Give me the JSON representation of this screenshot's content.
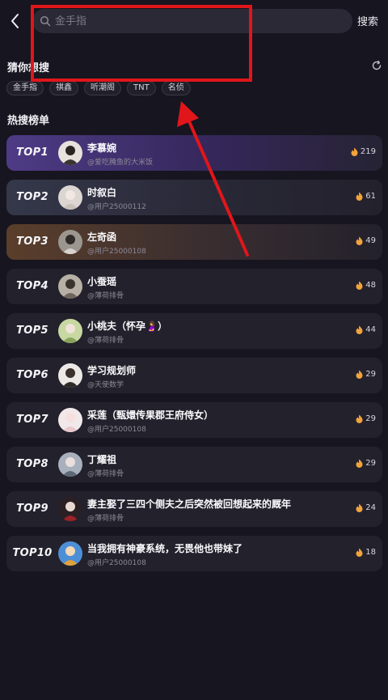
{
  "header": {
    "search_placeholder": "金手指",
    "search_button": "搜索"
  },
  "guess": {
    "title": "猜你想搜",
    "chips": [
      "金手指",
      "祺鑫",
      "听潮阁",
      "TNT",
      "名侦"
    ]
  },
  "hot": {
    "title": "热搜榜单",
    "items": [
      {
        "rank": "TOP1",
        "name": "李慕婉",
        "author": "@爱吃腌鱼的大米饭",
        "heat": "219"
      },
      {
        "rank": "TOP2",
        "name": "时叙白",
        "author": "@用户25000112",
        "heat": "61"
      },
      {
        "rank": "TOP3",
        "name": "左奇函",
        "author": "@用户25000108",
        "heat": "49"
      },
      {
        "rank": "TOP4",
        "name": "小蚕瑶",
        "author": "@薄荷排骨",
        "heat": "48"
      },
      {
        "rank": "TOP5",
        "name": "小桃夫（怀孕🤰）",
        "author": "@薄荷排骨",
        "heat": "44"
      },
      {
        "rank": "TOP6",
        "name": "学习规划师",
        "author": "@天使数学",
        "heat": "29"
      },
      {
        "rank": "TOP7",
        "name": "采莲（甄嬛传果郡王府侍女）",
        "author": "@用户25000108",
        "heat": "29"
      },
      {
        "rank": "TOP8",
        "name": "丁耀祖",
        "author": "@薄荷排骨",
        "heat": "29"
      },
      {
        "rank": "TOP9",
        "name": "妻主娶了三四个侧夫之后突然被回想起来的厩年",
        "author": "@薄荷排骨",
        "heat": "24"
      },
      {
        "rank": "TOP10",
        "name": "当我拥有神豪系统，无畏他也带妹了",
        "author": "@用户25000108",
        "heat": "18"
      }
    ]
  },
  "colors": {
    "annotation": "#e0161b",
    "fire": "#f2a33a"
  }
}
